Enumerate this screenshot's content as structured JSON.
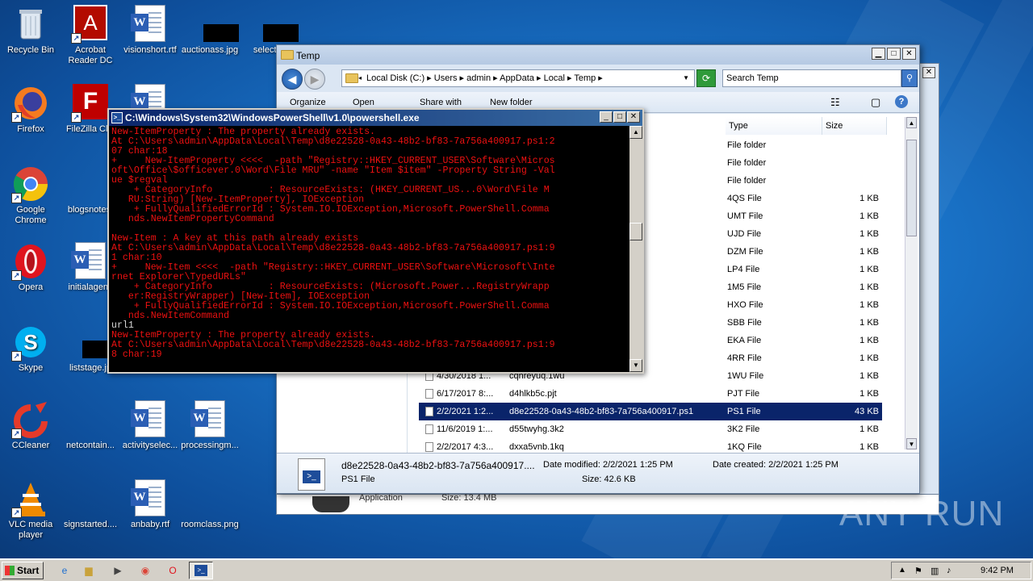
{
  "desktop": {
    "icons": [
      {
        "name": "recycle-bin",
        "label": "Recycle Bin"
      },
      {
        "name": "acrobat-reader",
        "label": "Acrobat Reader DC"
      },
      {
        "name": "visionshort-rtf",
        "label": "visionshort.rtf"
      },
      {
        "name": "auctionass-jpg",
        "label": "auctionass.jpg"
      },
      {
        "name": "selected",
        "label": "selectec"
      },
      {
        "name": "firefox",
        "label": "Firefox"
      },
      {
        "name": "filezilla",
        "label": "FileZilla Clie"
      },
      {
        "name": "chrome",
        "label": "Google Chrome"
      },
      {
        "name": "blogsnotes",
        "label": "blogsnotes."
      },
      {
        "name": "opera",
        "label": "Opera"
      },
      {
        "name": "initialagency",
        "label": "initialagenc"
      },
      {
        "name": "skype",
        "label": "Skype"
      },
      {
        "name": "liststage",
        "label": "liststage.jp"
      },
      {
        "name": "ccleaner",
        "label": "CCleaner"
      },
      {
        "name": "netcontain",
        "label": "netcontain..."
      },
      {
        "name": "activityselect",
        "label": "activityselec..."
      },
      {
        "name": "processingm",
        "label": "processingm..."
      },
      {
        "name": "vlc",
        "label": "VLC media player"
      },
      {
        "name": "signstarted",
        "label": "signstarted...."
      },
      {
        "name": "anbaby",
        "label": "anbaby.rtf"
      },
      {
        "name": "roomclass",
        "label": "roomclass.png"
      }
    ]
  },
  "explorer": {
    "title": "Temp",
    "breadcrumb": [
      "Local Disk (C:)",
      "Users",
      "admin",
      "AppData",
      "Local",
      "Temp"
    ],
    "search_placeholder": "Search Temp",
    "toolbar": {
      "organize": "Organize",
      "open": "Open",
      "share": "Share with",
      "new_folder": "New folder"
    },
    "columns": {
      "type": "Type",
      "size": "Size"
    },
    "rows": [
      {
        "date": "",
        "name": "",
        "type": "File folder",
        "size": ""
      },
      {
        "date": "",
        "name": "",
        "type": "File folder",
        "size": ""
      },
      {
        "date": "",
        "name": "",
        "type": "File folder",
        "size": ""
      },
      {
        "date": "",
        "name": "",
        "type": "4QS File",
        "size": "1 KB"
      },
      {
        "date": "",
        "name": "",
        "type": "UMT File",
        "size": "1 KB"
      },
      {
        "date": "",
        "name": "",
        "type": "UJD File",
        "size": "1 KB"
      },
      {
        "date": "",
        "name": "",
        "type": "DZM File",
        "size": "1 KB"
      },
      {
        "date": "",
        "name": "",
        "type": "LP4 File",
        "size": "1 KB"
      },
      {
        "date": "",
        "name": "",
        "type": "1M5 File",
        "size": "1 KB"
      },
      {
        "date": "",
        "name": "",
        "type": "HXO File",
        "size": "1 KB"
      },
      {
        "date": "",
        "name": "",
        "type": "SBB File",
        "size": "1 KB"
      },
      {
        "date": "",
        "name": "",
        "type": "EKA File",
        "size": "1 KB"
      },
      {
        "date": "",
        "name": "",
        "type": "4RR File",
        "size": "1 KB"
      },
      {
        "date": "4/30/2018 1...",
        "name": "cqhreyuq.1wu",
        "type": "1WU File",
        "size": "1 KB"
      },
      {
        "date": "6/17/2017 8:...",
        "name": "d4hlkb5c.pjt",
        "type": "PJT File",
        "size": "1 KB"
      },
      {
        "date": "2/2/2021 1:2...",
        "name": "d8e22528-0a43-48b2-bf83-7a756a400917.ps1",
        "type": "PS1 File",
        "size": "43 KB"
      },
      {
        "date": "11/6/2019 1:...",
        "name": "d55twyhg.3k2",
        "type": "3K2 File",
        "size": "1 KB"
      },
      {
        "date": "2/2/2017 4:3...",
        "name": "dxxa5vnb.1kq",
        "type": "1KQ File",
        "size": "1 KB"
      }
    ],
    "details": {
      "filename": "d8e22528-0a43-48b2-bf83-7a756a400917....",
      "filetype": "PS1 File",
      "date_modified": "Date modified: 2/2/2021 1:25 PM",
      "size": "Size: 42.6 KB",
      "date_created": "Date created: 2/2/2021 1:25 PM"
    },
    "back_strip": {
      "type": "Application",
      "size": "Size: 13.4 MB"
    }
  },
  "powershell": {
    "title": "C:\\Windows\\System32\\WindowsPowerShell\\v1.0\\powershell.exe",
    "lines_red_1": "New-ItemProperty : The property already exists.\nAt C:\\Users\\admin\\AppData\\Local\\Temp\\d8e22528-0a43-48b2-bf83-7a756a400917.ps1:2\n07 char:18\n+     New-ItemProperty <<<<  -path \"Registry::HKEY_CURRENT_USER\\Software\\Micros\noft\\Office\\$officever.0\\Word\\File MRU\" -name \"Item $item\" -Property String -Val\nue $regval\n    + CategoryInfo          : ResourceExists: (HKEY_CURRENT_US...0\\Word\\File M\n   RU:String) [New-ItemProperty], IOException\n    + FullyQualifiedErrorId : System.IO.IOException,Microsoft.PowerShell.Comma\n   nds.NewItemPropertyCommand\n\nNew-Item : A key at this path already exists\nAt C:\\Users\\admin\\AppData\\Local\\Temp\\d8e22528-0a43-48b2-bf83-7a756a400917.ps1:9\n1 char:10\n+     New-Item <<<<  -path \"Registry::HKEY_CURRENT_USER\\Software\\Microsoft\\Inte\nrnet Explorer\\TypedURLs\"\n    + CategoryInfo          : ResourceExists: (Microsoft.Power...RegistryWrapp\n   er:RegistryWrapper) [New-Item], IOException\n    + FullyQualifiedErrorId : System.IO.IOException,Microsoft.PowerShell.Comma\n   nds.NewItemCommand\n",
    "line_white": "url1",
    "lines_red_2": "New-ItemProperty : The property already exists.\nAt C:\\Users\\admin\\AppData\\Local\\Temp\\d8e22528-0a43-48b2-bf83-7a756a400917.ps1:9\n8 char:19"
  },
  "taskbar": {
    "start": "Start",
    "clock": "9:42 PM"
  },
  "watermark": "ANY RUN"
}
